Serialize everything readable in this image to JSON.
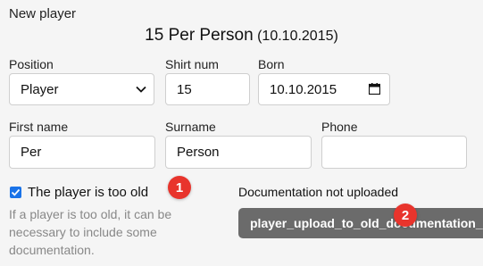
{
  "section_title": "New player",
  "header": {
    "name": "15 Per Person",
    "date": "(10.10.2015)"
  },
  "fields": {
    "position": {
      "label": "Position",
      "value": "Player"
    },
    "shirt_num": {
      "label": "Shirt num",
      "value": "15"
    },
    "born": {
      "label": "Born",
      "value": "10.10.2015"
    },
    "first_name": {
      "label": "First name",
      "value": "Per"
    },
    "surname": {
      "label": "Surname",
      "value": "Person"
    },
    "phone": {
      "label": "Phone",
      "value": ""
    }
  },
  "too_old": {
    "label": "The player is too old",
    "checked": true,
    "help": "If a player is too old, it can be necessary to include some documentation."
  },
  "documentation": {
    "status": "Documentation not uploaded",
    "upload_label": "player_upload_to_old_documentation_la"
  },
  "badges": [
    "1",
    "2"
  ],
  "colors": {
    "checkbox": "#1a73e8",
    "badge": "#e8342c",
    "upload_button": "#6b6b6b"
  }
}
